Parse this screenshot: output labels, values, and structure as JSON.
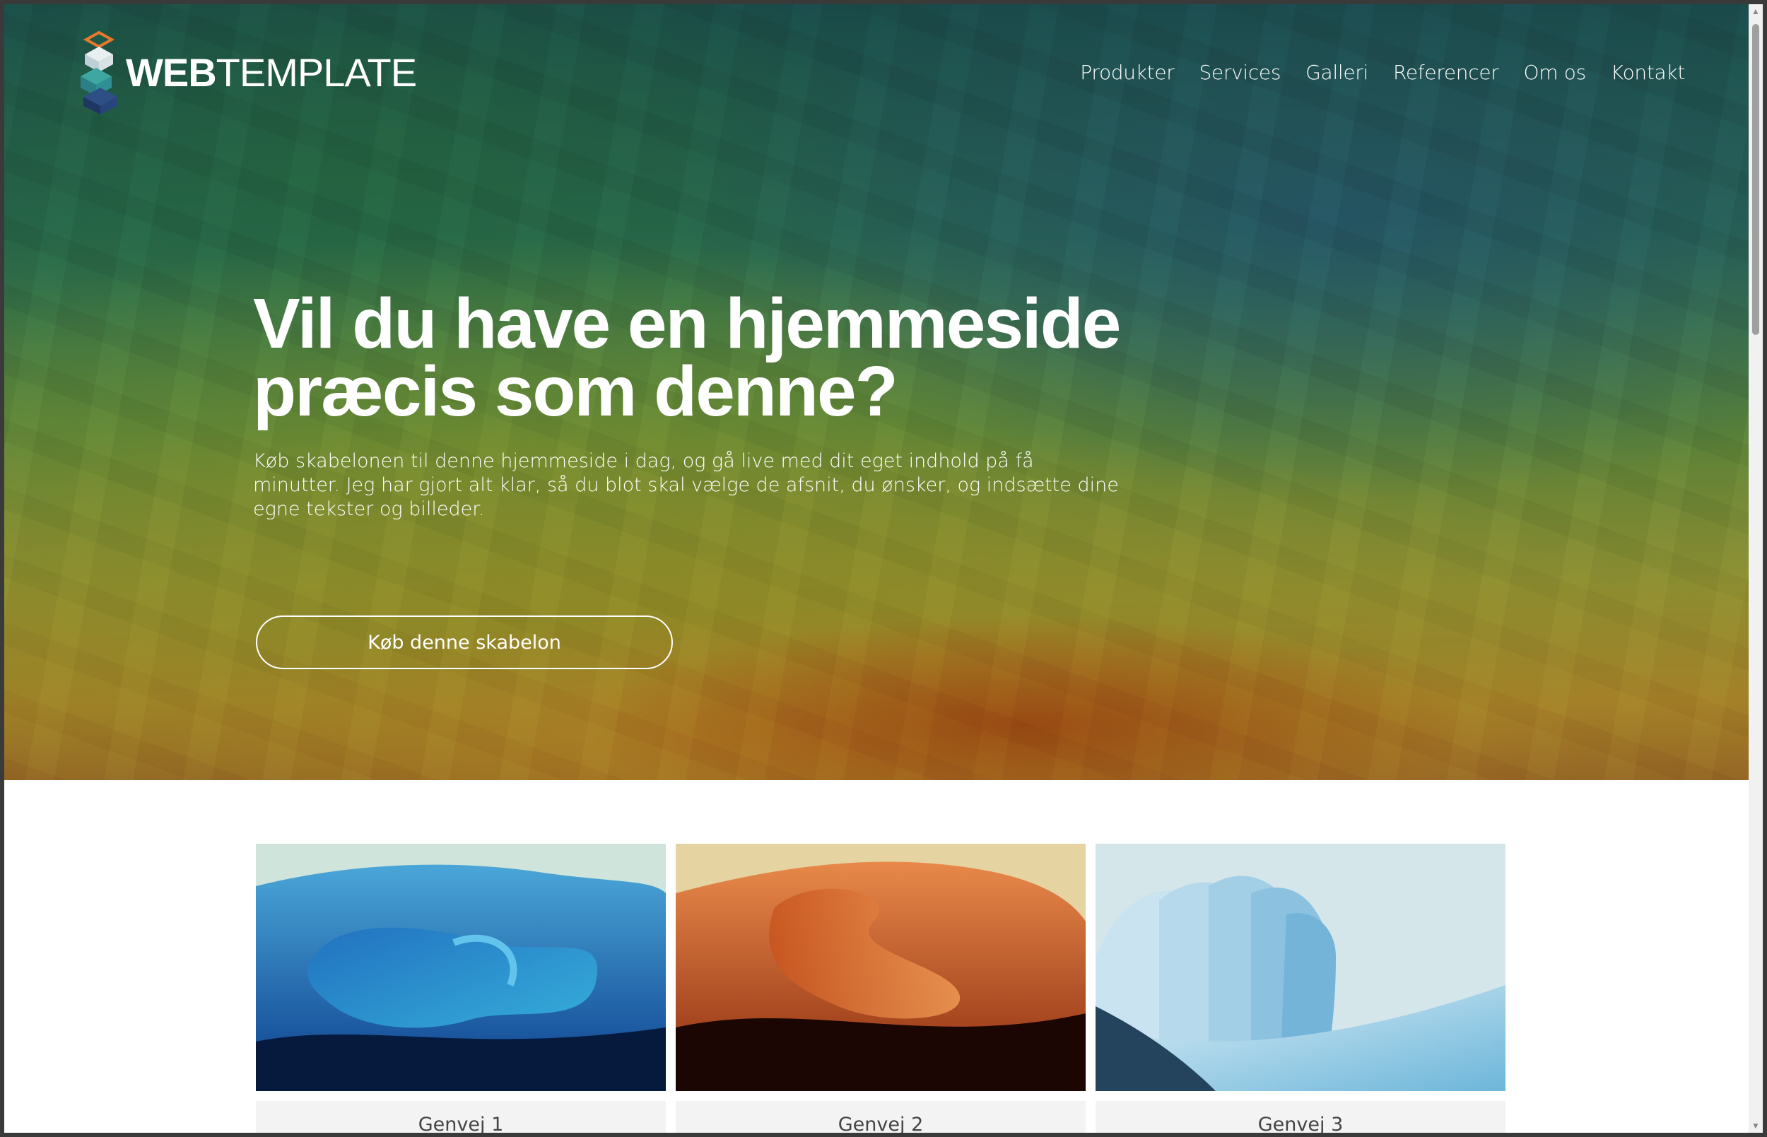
{
  "header": {
    "logo_bold": "WEB",
    "logo_light": "TEMPLATE",
    "nav": [
      {
        "label": "Produkter"
      },
      {
        "label": "Services"
      },
      {
        "label": "Galleri"
      },
      {
        "label": "Referencer"
      },
      {
        "label": "Om os"
      },
      {
        "label": "Kontakt"
      }
    ]
  },
  "hero": {
    "title_line1": "Vil du have en hjemmeside",
    "title_line2": "præcis som denne?",
    "text": "Køb skabelonen til denne hjemmeside i dag, og gå live med dit eget indhold på få minutter. Jeg har gjort alt klar, så du blot skal vælge de afsnit, du ønsker, og indsætte dine egne tekster og billeder.",
    "cta_label": "Køb denne skabelon"
  },
  "cards": [
    {
      "label": "Genvej 1"
    },
    {
      "label": "Genvej 2"
    },
    {
      "label": "Genvej 3"
    }
  ],
  "colors": {
    "nav_text": "#ffffff",
    "card_label_bg": "#f3f3f3",
    "card_label_text": "#444444"
  },
  "icons": {
    "logo": "stacked-cubes-logo-icon",
    "scroll_up": "scroll-up-arrow-icon",
    "scroll_down": "scroll-down-arrow-icon"
  }
}
